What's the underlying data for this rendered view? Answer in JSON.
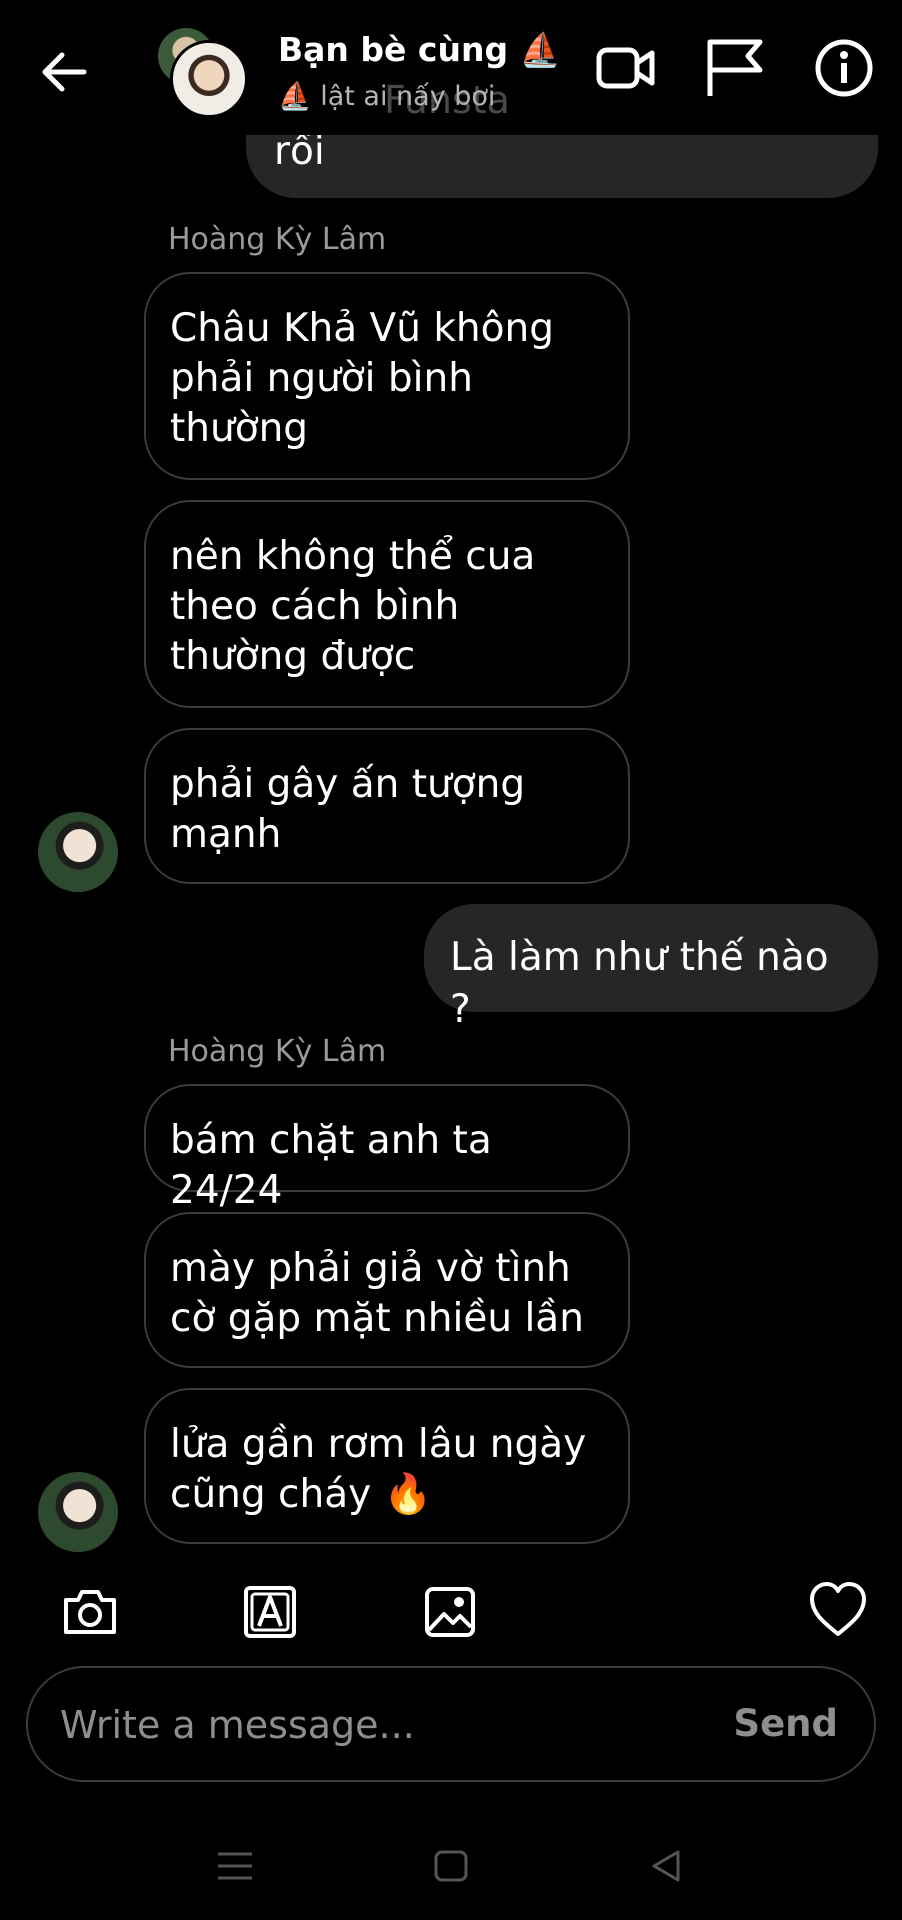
{
  "header": {
    "title": "Bạn bè cùng ⛵",
    "subtitle": "⛵ lật ai nấy bơi",
    "ghost_text": "Funsta",
    "icons": [
      "back-arrow-icon",
      "video-call-icon",
      "flag-icon",
      "info-icon"
    ]
  },
  "messages": [
    {
      "side": "out",
      "text": "rồi"
    },
    {
      "side": "in",
      "sender": "Hoàng Kỳ Lâm",
      "text": "Châu Khả Vũ không phải người bình thường"
    },
    {
      "side": "in",
      "text": "nên không thể cua theo cách bình thường được"
    },
    {
      "side": "in",
      "text": "phải gây ấn tượng mạnh"
    },
    {
      "side": "out",
      "text": "Là làm như thế nào ?"
    },
    {
      "side": "in",
      "sender": "Hoàng Kỳ Lâm",
      "text": "bám chặt anh ta 24/24"
    },
    {
      "side": "in",
      "text": "mày phải giả vờ tình cờ gặp mặt nhiều lần"
    },
    {
      "side": "in",
      "text": "lửa gần rơm lâu ngày cũng cháy 🔥"
    }
  ],
  "composer": {
    "placeholder": "Write a message...",
    "send_label": "Send",
    "tools": [
      "camera-icon",
      "sticker-icon",
      "gallery-icon",
      "heart-icon"
    ]
  },
  "nav": [
    "recents-icon",
    "home-icon",
    "back-icon"
  ],
  "colors": {
    "background": "#000000",
    "outgoing_bubble": "#262626",
    "incoming_border": "#3a3a3a",
    "muted_text": "#8e8e8e"
  }
}
